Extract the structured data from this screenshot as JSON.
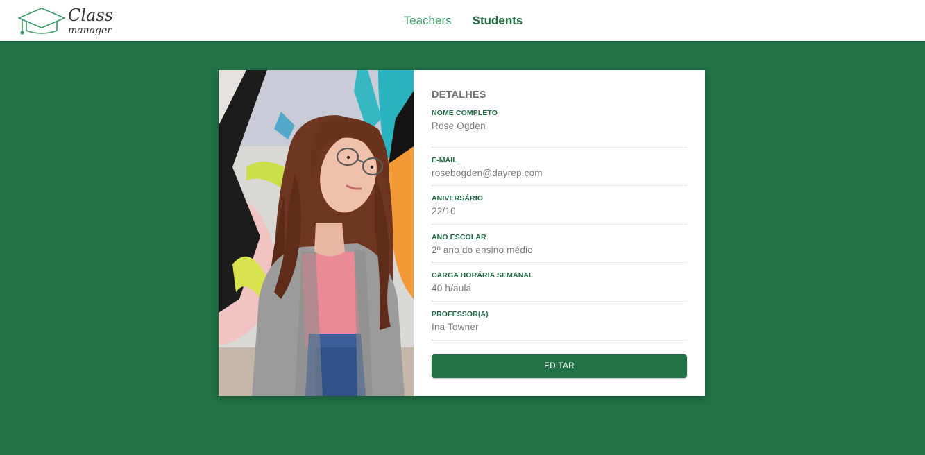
{
  "app": {
    "logo_line1": "Class",
    "logo_line2": "manager"
  },
  "nav": {
    "teachers": "Teachers",
    "students": "Students"
  },
  "details": {
    "title": "DETALHES",
    "fields": [
      {
        "label": "NOME COMPLETO",
        "value": "Rose Ogden"
      },
      {
        "label": "E-MAIL",
        "value": "rosebogden@dayrep.com"
      },
      {
        "label": "ANIVERSÁRIO",
        "value": "22/10"
      },
      {
        "label": "ANO ESCOLAR",
        "value": "2º ano do ensino médio"
      },
      {
        "label": "CARGA HORÁRIA SEMANAL",
        "value": "40 h/aula"
      },
      {
        "label": "PROFESSOR(A)",
        "value": "Ina Towner"
      }
    ],
    "edit_label": "EDITAR"
  },
  "colors": {
    "brand_green": "#227247",
    "label_green": "#1f6a40",
    "nav_inactive": "#3a9a63"
  },
  "icons": {
    "logo": "graduation-cap-icon"
  }
}
